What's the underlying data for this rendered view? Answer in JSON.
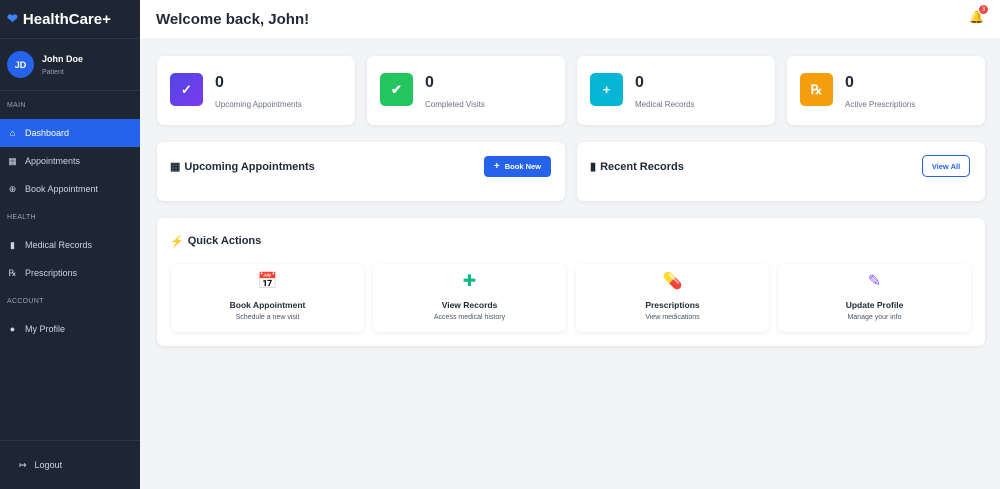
{
  "brand": {
    "name": "HealthCare+"
  },
  "user": {
    "initials": "JD",
    "name": "John Doe",
    "role": "Patient"
  },
  "sidebar": {
    "sections": [
      {
        "label": "MAIN",
        "items": [
          {
            "label": "Dashboard",
            "icon": "home-icon",
            "active": true
          },
          {
            "label": "Appointments",
            "icon": "calendar-icon"
          },
          {
            "label": "Book Appointment",
            "icon": "plus-circle-icon"
          }
        ]
      },
      {
        "label": "HEALTH",
        "items": [
          {
            "label": "Medical Records",
            "icon": "file-medical-icon"
          },
          {
            "label": "Prescriptions",
            "icon": "prescription-icon"
          }
        ]
      },
      {
        "label": "ACCOUNT",
        "items": [
          {
            "label": "My Profile",
            "icon": "user-icon"
          }
        ]
      }
    ],
    "logout": "Logout"
  },
  "header": {
    "title": "Welcome back, John!",
    "notifications": "3"
  },
  "stats": [
    {
      "value": "0",
      "label": "Upcoming Appointments",
      "color": "#5b4be0"
    },
    {
      "value": "0",
      "label": "Completed Visits",
      "color": "#22c55e"
    },
    {
      "value": "0",
      "label": "Medical Records",
      "color": "#06b6d4"
    },
    {
      "value": "0",
      "label": "Active Prescriptions",
      "color": "#f59e0b"
    }
  ],
  "panels": {
    "upcoming": {
      "title": "Upcoming Appointments",
      "button": "Book New"
    },
    "records": {
      "title": "Recent Records",
      "button": "View All"
    }
  },
  "quick_actions": {
    "title": "Quick Actions",
    "items": [
      {
        "name": "Book Appointment",
        "desc": "Schedule a new visit",
        "color": "#2563eb"
      },
      {
        "name": "View Records",
        "desc": "Access medical history",
        "color": "#10b981"
      },
      {
        "name": "Prescriptions",
        "desc": "View medications",
        "color": "#f59e0b"
      },
      {
        "name": "Update Profile",
        "desc": "Manage your info",
        "color": "#8b5cf6"
      }
    ]
  }
}
